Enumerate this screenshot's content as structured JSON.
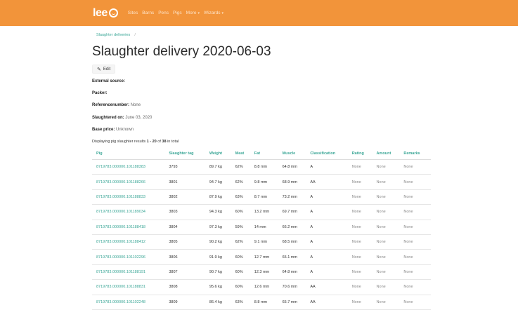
{
  "header": {
    "logo": "lee",
    "nav": [
      {
        "label": "Sites",
        "caret": ""
      },
      {
        "label": "Barns",
        "caret": ""
      },
      {
        "label": "Pens",
        "caret": ""
      },
      {
        "label": "Pigs",
        "caret": ""
      },
      {
        "label": "More",
        "caret": "▾"
      },
      {
        "label": "Wizards",
        "caret": "▾"
      }
    ]
  },
  "breadcrumb": {
    "item": "Slaughter deliveries",
    "sep": "/"
  },
  "page": {
    "title": "Slaughter delivery 2020-06-03",
    "edit_label": "Edit"
  },
  "fields": {
    "external_source_label": "External source:",
    "packer_label": "Packer:",
    "reference_label": "Referencenumber:",
    "reference_value": "None",
    "slaughtered_label": "Slaughtered on:",
    "slaughtered_value": "June 03, 2020",
    "base_price_label": "Base price:",
    "base_price_value": "Unknown"
  },
  "summary": {
    "prefix": "Displaying pig slaughter results",
    "range": "1 - 20",
    "of": "of",
    "total": "38",
    "suffix": "in total"
  },
  "table": {
    "headers": [
      "Pig",
      "Slaughter tag",
      "Weight",
      "Meat",
      "Fat",
      "Muscle",
      "Classification",
      "Rating",
      "Amount",
      "Remarks"
    ],
    "rows": [
      {
        "pig": "8719783.000000.101188383",
        "tag": "3793",
        "weight": "89.7 kg",
        "meat": "62%",
        "fat": "8.8 mm",
        "muscle": "64.8 mm",
        "class": "A",
        "rating": "None",
        "amount": "None",
        "remarks": "None"
      },
      {
        "pig": "8719783.000000.101188266",
        "tag": "3801",
        "weight": "94.7 kg",
        "meat": "62%",
        "fat": "9.8 mm",
        "muscle": "68.9 mm",
        "class": "AA",
        "rating": "None",
        "amount": "None",
        "remarks": "None"
      },
      {
        "pig": "8719783.000000.101188833",
        "tag": "3802",
        "weight": "87.9 kg",
        "meat": "63%",
        "fat": "8.7 mm",
        "muscle": "73.2 mm",
        "class": "A",
        "rating": "None",
        "amount": "None",
        "remarks": "None"
      },
      {
        "pig": "8719783.000000.101189034",
        "tag": "3803",
        "weight": "94.3 kg",
        "meat": "60%",
        "fat": "13.2 mm",
        "muscle": "69.7 mm",
        "class": "A",
        "rating": "None",
        "amount": "None",
        "remarks": "None"
      },
      {
        "pig": "8719783.000000.101188418",
        "tag": "3804",
        "weight": "97.3 kg",
        "meat": "59%",
        "fat": "14 mm",
        "muscle": "66.2 mm",
        "class": "A",
        "rating": "None",
        "amount": "None",
        "remarks": "None"
      },
      {
        "pig": "8719783.000000.101188412",
        "tag": "3805",
        "weight": "90.2 kg",
        "meat": "62%",
        "fat": "9.1 mm",
        "muscle": "68.5 mm",
        "class": "A",
        "rating": "None",
        "amount": "None",
        "remarks": "None"
      },
      {
        "pig": "8719783.000000.101102296",
        "tag": "3806",
        "weight": "91.9 kg",
        "meat": "60%",
        "fat": "12.7 mm",
        "muscle": "65.1 mm",
        "class": "A",
        "rating": "None",
        "amount": "None",
        "remarks": "None"
      },
      {
        "pig": "8719783.000000.101188191",
        "tag": "3807",
        "weight": "90.7 kg",
        "meat": "60%",
        "fat": "12.3 mm",
        "muscle": "64.8 mm",
        "class": "A",
        "rating": "None",
        "amount": "None",
        "remarks": "None"
      },
      {
        "pig": "8719783.000000.101188831",
        "tag": "3808",
        "weight": "95.6 kg",
        "meat": "60%",
        "fat": "12.6 mm",
        "muscle": "70.6 mm",
        "class": "AA",
        "rating": "None",
        "amount": "None",
        "remarks": "None"
      },
      {
        "pig": "8719783.000000.101102248",
        "tag": "3809",
        "weight": "86.4 kg",
        "meat": "63%",
        "fat": "8.8 mm",
        "muscle": "65.7 mm",
        "class": "AA",
        "rating": "None",
        "amount": "None",
        "remarks": "None"
      }
    ]
  },
  "colors": {
    "brand": "#f2943a",
    "link": "#3aa696"
  }
}
